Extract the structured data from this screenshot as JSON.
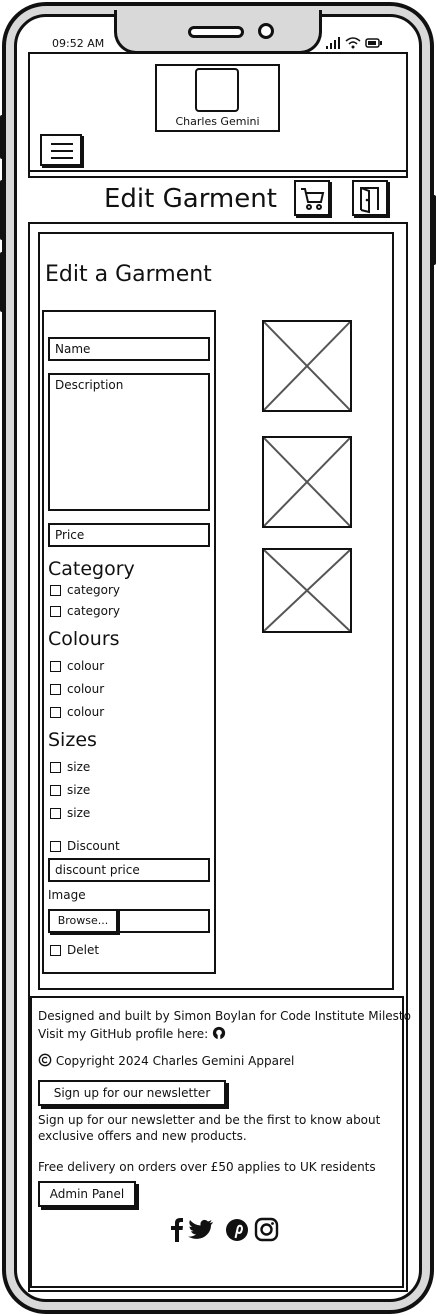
{
  "status_bar": {
    "time": "09:52 AM"
  },
  "header": {
    "logo_text": "Charles Gemini"
  },
  "title_bar": {
    "title": "Edit Garment"
  },
  "form": {
    "heading": "Edit a Garment",
    "name_placeholder": "Name",
    "description_placeholder": "Description",
    "price_placeholder": "Price",
    "category_heading": "Category",
    "categories": [
      "category",
      "category"
    ],
    "colours_heading": "Colours",
    "colours": [
      "colour",
      "colour",
      "colour"
    ],
    "sizes_heading": "Sizes",
    "sizes": [
      "size",
      "size",
      "size"
    ],
    "discount_label": "Discount",
    "discount_price_placeholder": "discount price",
    "image_label": "Image",
    "browse_label": "Browse...",
    "delete_label": "Delet"
  },
  "footer": {
    "built_by": "Designed and built by Simon Boylan for Code Institute Milesto",
    "github_text": "Visit my GitHub profile here:",
    "copyright": "Copyright 2024 Charles Gemini Apparel",
    "newsletter_button": "Sign up for our newsletter",
    "newsletter_text_1": "Sign up for our newsletter and be the first to know about",
    "newsletter_text_2": "exclusive offers and new products.",
    "delivery_text": "Free delivery on orders over £50 applies to UK residents",
    "admin_button": "Admin Panel"
  },
  "icons": [
    "hamburger-menu-icon",
    "cart-icon",
    "logout-door-icon",
    "github-icon",
    "copyright-icon",
    "facebook-icon",
    "twitter-icon",
    "pinterest-icon",
    "instagram-icon"
  ]
}
